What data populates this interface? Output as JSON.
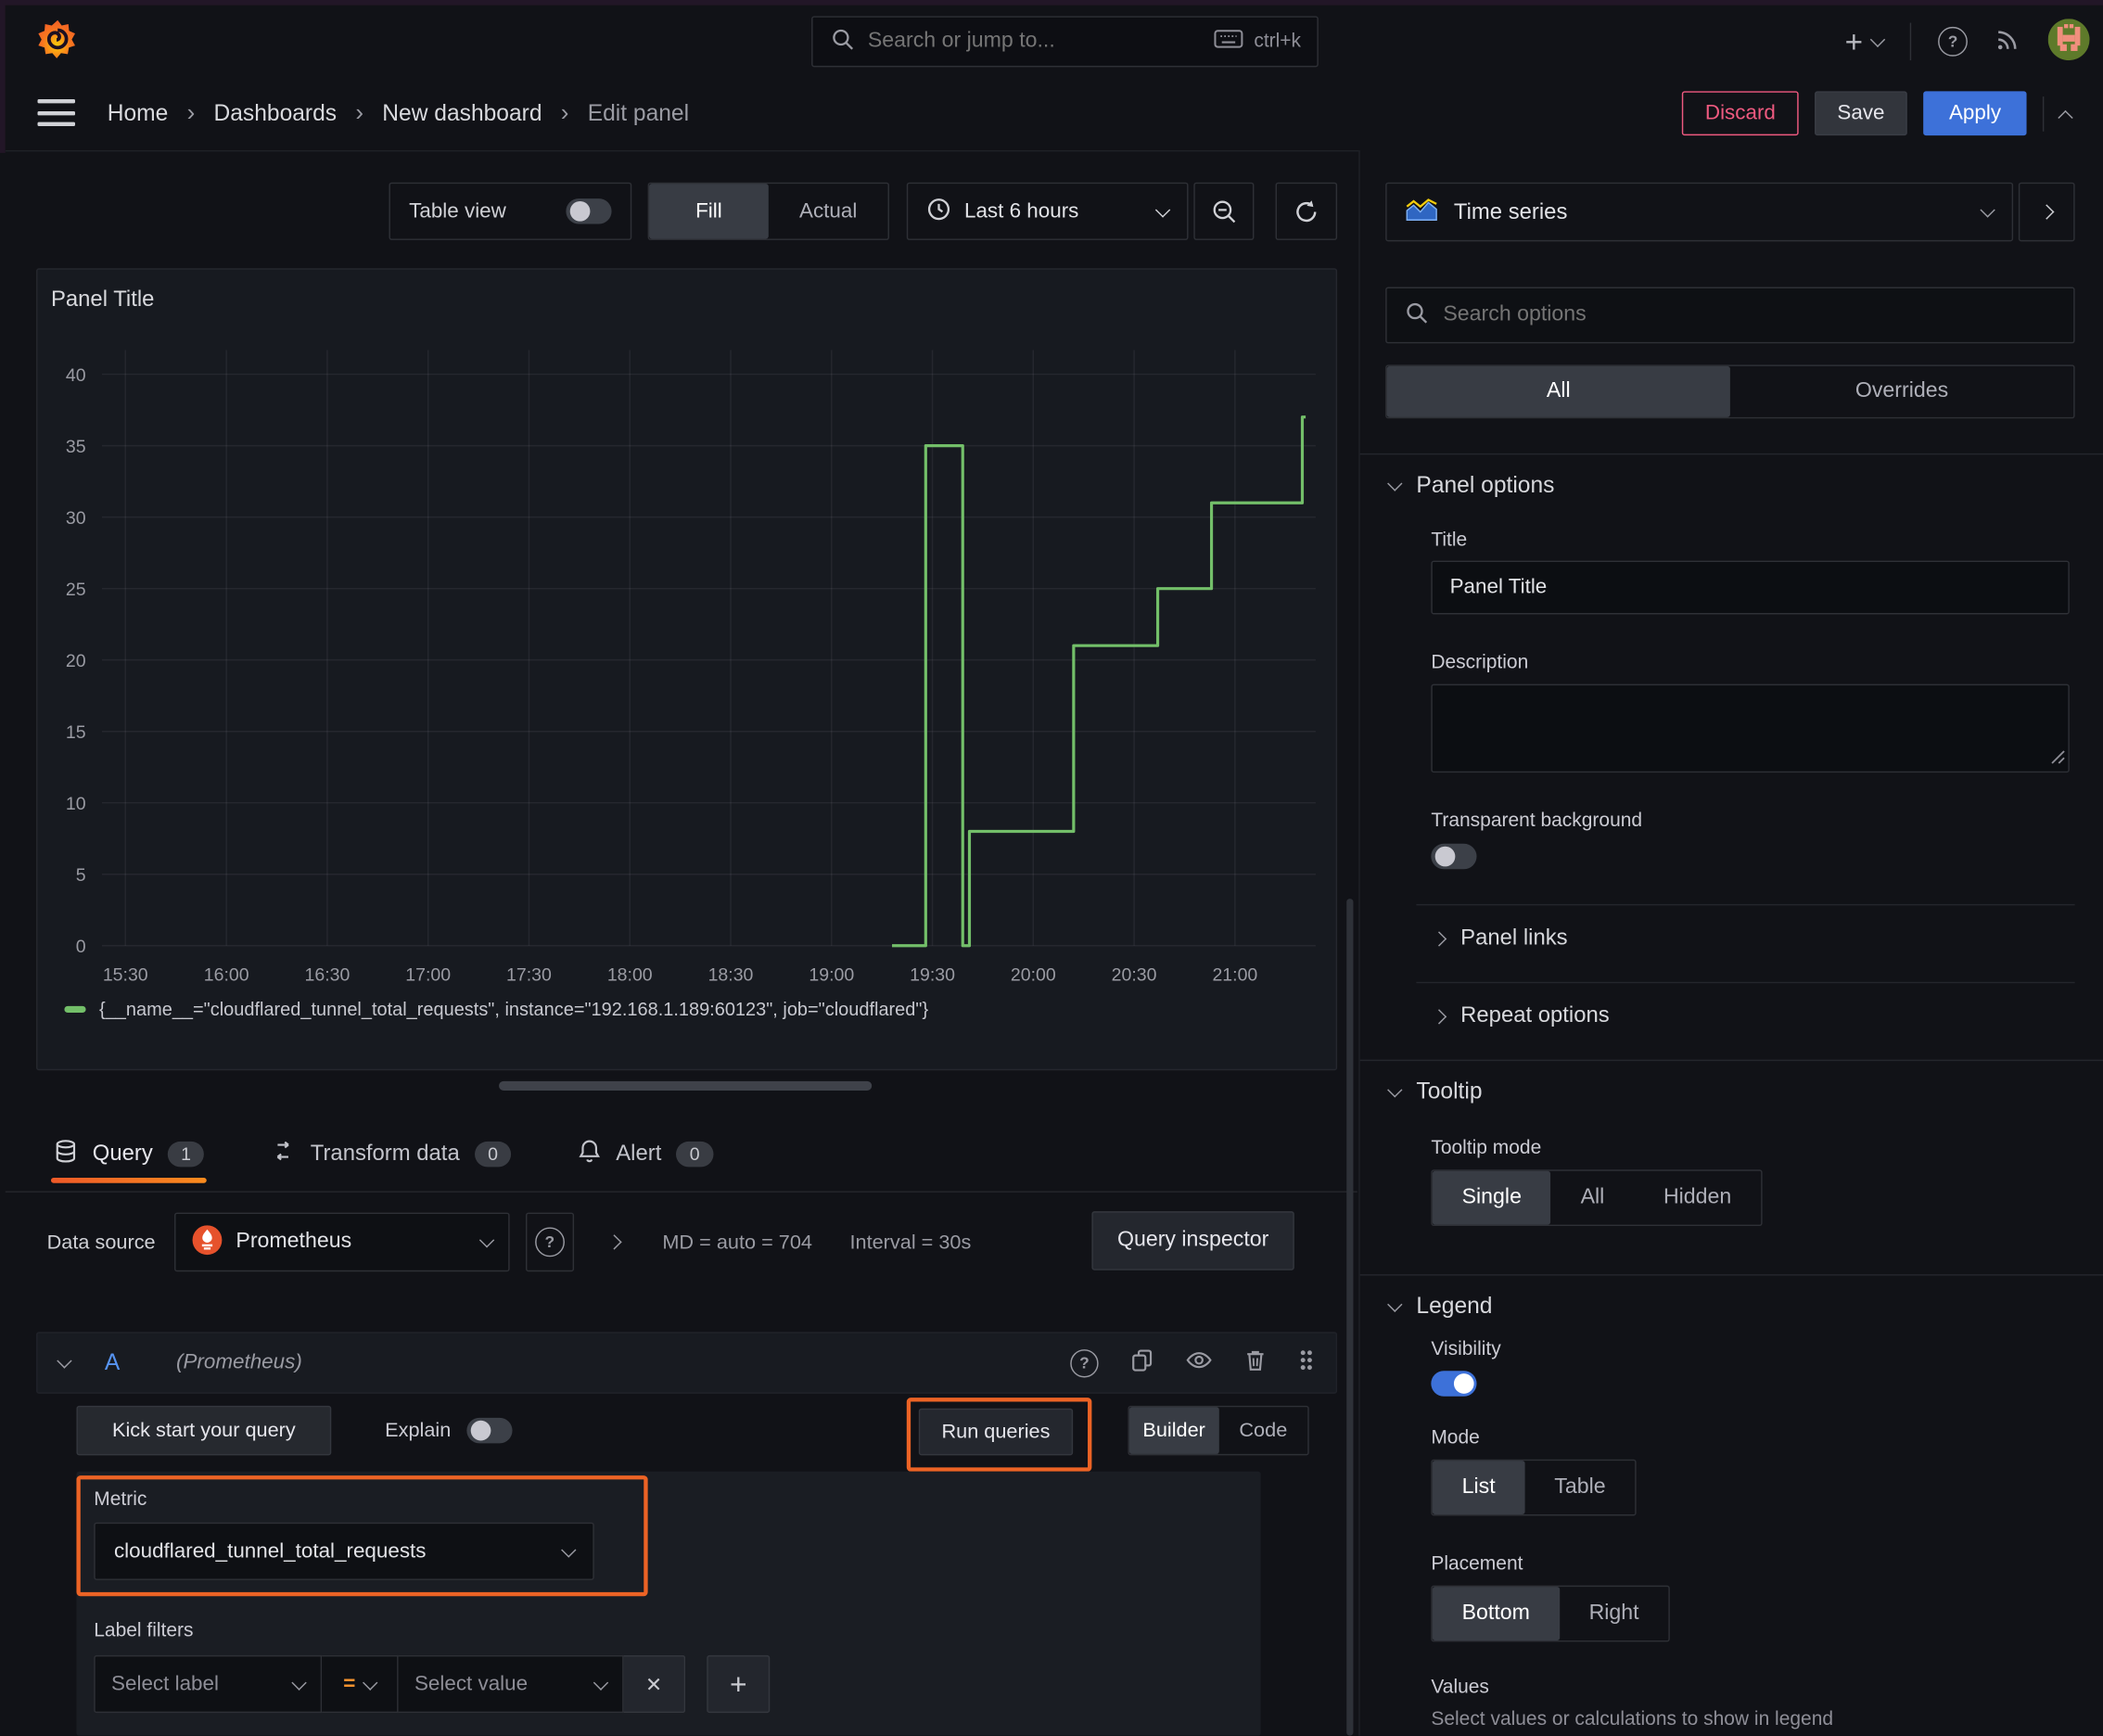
{
  "nav": {
    "search": {
      "placeholder": "Search or jump to...",
      "shortcut": "ctrl+k"
    }
  },
  "breadcrumb": {
    "separator": "›",
    "items": [
      {
        "label": "Home"
      },
      {
        "label": "Dashboards"
      },
      {
        "label": "New dashboard"
      },
      {
        "label": "Edit panel"
      }
    ]
  },
  "actions": {
    "discard": "Discard",
    "save": "Save",
    "apply": "Apply"
  },
  "toolbar": {
    "table_view": "Table view",
    "fill": "Fill",
    "actual": "Actual",
    "time_range": "Last 6 hours"
  },
  "panel": {
    "title": "Panel Title"
  },
  "chart_data": {
    "type": "line",
    "title": "Panel Title",
    "x_ticks": [
      "15:30",
      "16:00",
      "16:30",
      "17:00",
      "17:30",
      "18:00",
      "18:30",
      "19:00",
      "19:30",
      "20:00",
      "20:30",
      "21:00"
    ],
    "y_ticks": [
      0,
      5,
      10,
      15,
      20,
      25,
      30,
      35,
      40
    ],
    "ylim": [
      0,
      40
    ],
    "x_range_minutes": [
      923,
      1284
    ],
    "x_end": "21:21",
    "grid": true,
    "legend_position": "bottom",
    "series": [
      {
        "name": "{__name__=\"cloudflared_tunnel_total_requests\", instance=\"192.168.1.189:60123\", job=\"cloudflared\"}",
        "color": "#73bf69",
        "mode": "step-after",
        "points": [
          [
            "19:18",
            0
          ],
          [
            "19:28",
            35
          ],
          [
            "19:39",
            0
          ],
          [
            "19:41",
            8
          ],
          [
            "20:12",
            21
          ],
          [
            "20:37",
            25
          ],
          [
            "20:53",
            31
          ],
          [
            "21:20",
            37
          ]
        ]
      }
    ]
  },
  "query_section": {
    "tabs": [
      {
        "label": "Query",
        "count": "1"
      },
      {
        "label": "Transform data",
        "count": "0"
      },
      {
        "label": "Alert",
        "count": "0"
      }
    ],
    "datasource_label": "Data source",
    "datasource": "Prometheus",
    "stats": "MD = auto = 704",
    "interval": "Interval = 30s",
    "query_inspector": "Query inspector",
    "query_row": {
      "letter": "A",
      "datasource_hint": "(Prometheus)"
    },
    "kick_start": "Kick start your query",
    "explain": "Explain",
    "run_queries": "Run queries",
    "builder": "Builder",
    "code": "Code",
    "metric": {
      "label": "Metric",
      "value": "cloudflared_tunnel_total_requests"
    },
    "label_filters": {
      "label": "Label filters",
      "select_label": "Select label",
      "operator": "=",
      "select_value": "Select value"
    }
  },
  "options": {
    "viz": "Time series",
    "search_placeholder": "Search options",
    "tab_all": "All",
    "tab_overrides": "Overrides",
    "panel_options": {
      "title": "Panel options",
      "title_label": "Title",
      "title_value": "Panel Title",
      "description_label": "Description",
      "transparent_label": "Transparent background"
    },
    "collapsed": [
      {
        "label": "Panel links"
      },
      {
        "label": "Repeat options"
      }
    ],
    "tooltip": {
      "title": "Tooltip",
      "mode_label": "Tooltip mode",
      "modes": [
        "Single",
        "All",
        "Hidden"
      ],
      "selected": "Single"
    },
    "legend": {
      "title": "Legend",
      "visibility_label": "Visibility",
      "mode_label": "Mode",
      "modes": [
        "List",
        "Table"
      ],
      "selected_mode": "List",
      "placement_label": "Placement",
      "placements": [
        "Bottom",
        "Right"
      ],
      "selected_placement": "Bottom",
      "values_label": "Values",
      "values_help": "Select values or calculations to show in legend"
    }
  },
  "icons": {
    "plus": "+",
    "close": "✕",
    "help": "?",
    "add_filter": "+"
  },
  "colors": {
    "accent_blue": "#3d71d9",
    "series_green": "#73bf69",
    "annotation_orange": "#ec6325",
    "discard_red": "#ef5a80",
    "tab_underline_orange": "#f05a28",
    "prometheus_orange": "#e6522c"
  }
}
